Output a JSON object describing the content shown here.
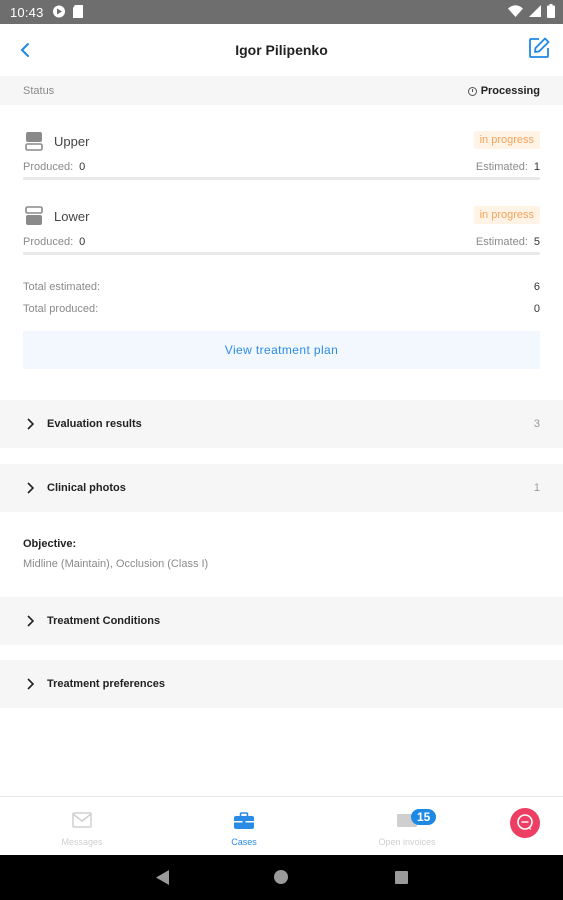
{
  "statusbar": {
    "time": "10:43",
    "left_icons": [
      "play-store-icon",
      "sd-card-icon"
    ],
    "right_icons": [
      "wifi-icon",
      "signal-icon",
      "battery-icon"
    ]
  },
  "appbar": {
    "title": "Igor Pilipenko",
    "back_icon": "chevron-left-icon",
    "edit_icon": "edit-icon"
  },
  "status": {
    "label": "Status",
    "value": "Processing"
  },
  "jaws": [
    {
      "name": "Upper",
      "badge": "in progress",
      "produced_label": "Produced:",
      "produced": "0",
      "estimated_label": "Estimated:",
      "estimated": "1",
      "progress": 0
    },
    {
      "name": "Lower",
      "badge": "in progress",
      "produced_label": "Produced:",
      "produced": "0",
      "estimated_label": "Estimated:",
      "estimated": "5",
      "progress": 0
    }
  ],
  "totals": {
    "estimated_label": "Total estimated:",
    "estimated": "6",
    "produced_label": "Total produced:",
    "produced": "0"
  },
  "view_plan_label": "View treatment plan",
  "sections": {
    "evaluation": {
      "label": "Evaluation results",
      "count": "3"
    },
    "photos": {
      "label": "Clinical photos",
      "count": "1"
    },
    "conditions": {
      "label": "Treatment Conditions"
    },
    "preferences": {
      "label": "Treatment preferences"
    }
  },
  "objective": {
    "heading": "Objective:",
    "text": "Midline (Maintain), Occlusion (Class I)"
  },
  "bottom_nav": {
    "messages": "Messages",
    "cases": "Cases",
    "open_invoices": "Open invoices",
    "invoices_badge": "15",
    "active": "cases"
  },
  "colors": {
    "accent": "#1e88e5",
    "badge_bg": "#fff3e6",
    "badge_text": "#f3a35a",
    "chat_fab": "#ec3f63"
  }
}
